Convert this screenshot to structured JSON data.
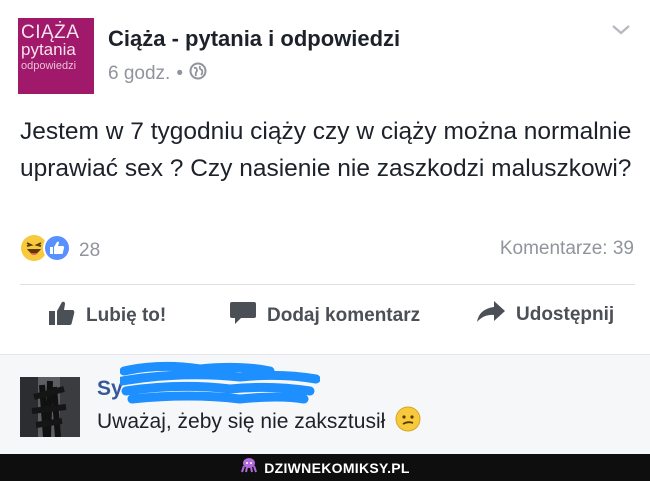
{
  "post": {
    "avatar_lines": [
      "CIĄŻA",
      "pytania",
      "odpowiedzi"
    ],
    "page_name": "Ciąża - pytania i odpowiedzi",
    "time": "6 godz.",
    "separator": "•",
    "privacy_icon": "globe-icon",
    "menu_icon": "chevron-down-icon",
    "text": "Jestem w 7 tygodniu ciąży czy w ciąży można normalnie uprawiać sex ? Czy nasienie nie zaszkodzi maluszkowi?",
    "reaction_icons": [
      "laughing-emoji-icon",
      "like-thumb-icon"
    ],
    "reaction_count": "28",
    "comments_count": "Komentarze: 39"
  },
  "actions": {
    "like_label": "Lubię to!",
    "comment_label": "Dodaj komentarz",
    "share_label": "Udostępnij"
  },
  "comment": {
    "author_visible": "Sy",
    "text": "Uważaj, żeby się nie zaksztusił",
    "emoji_icon": "confused-emoji-icon"
  },
  "footer": {
    "brand": "DZIWNEKOMIKSY.PL",
    "icon": "octopus-icon"
  },
  "colors": {
    "avatar_bg": "#a0196b",
    "link_blue": "#365899",
    "like_blue": "#5890ff",
    "scribble_blue": "#1e8fff",
    "muted": "#90949c"
  }
}
